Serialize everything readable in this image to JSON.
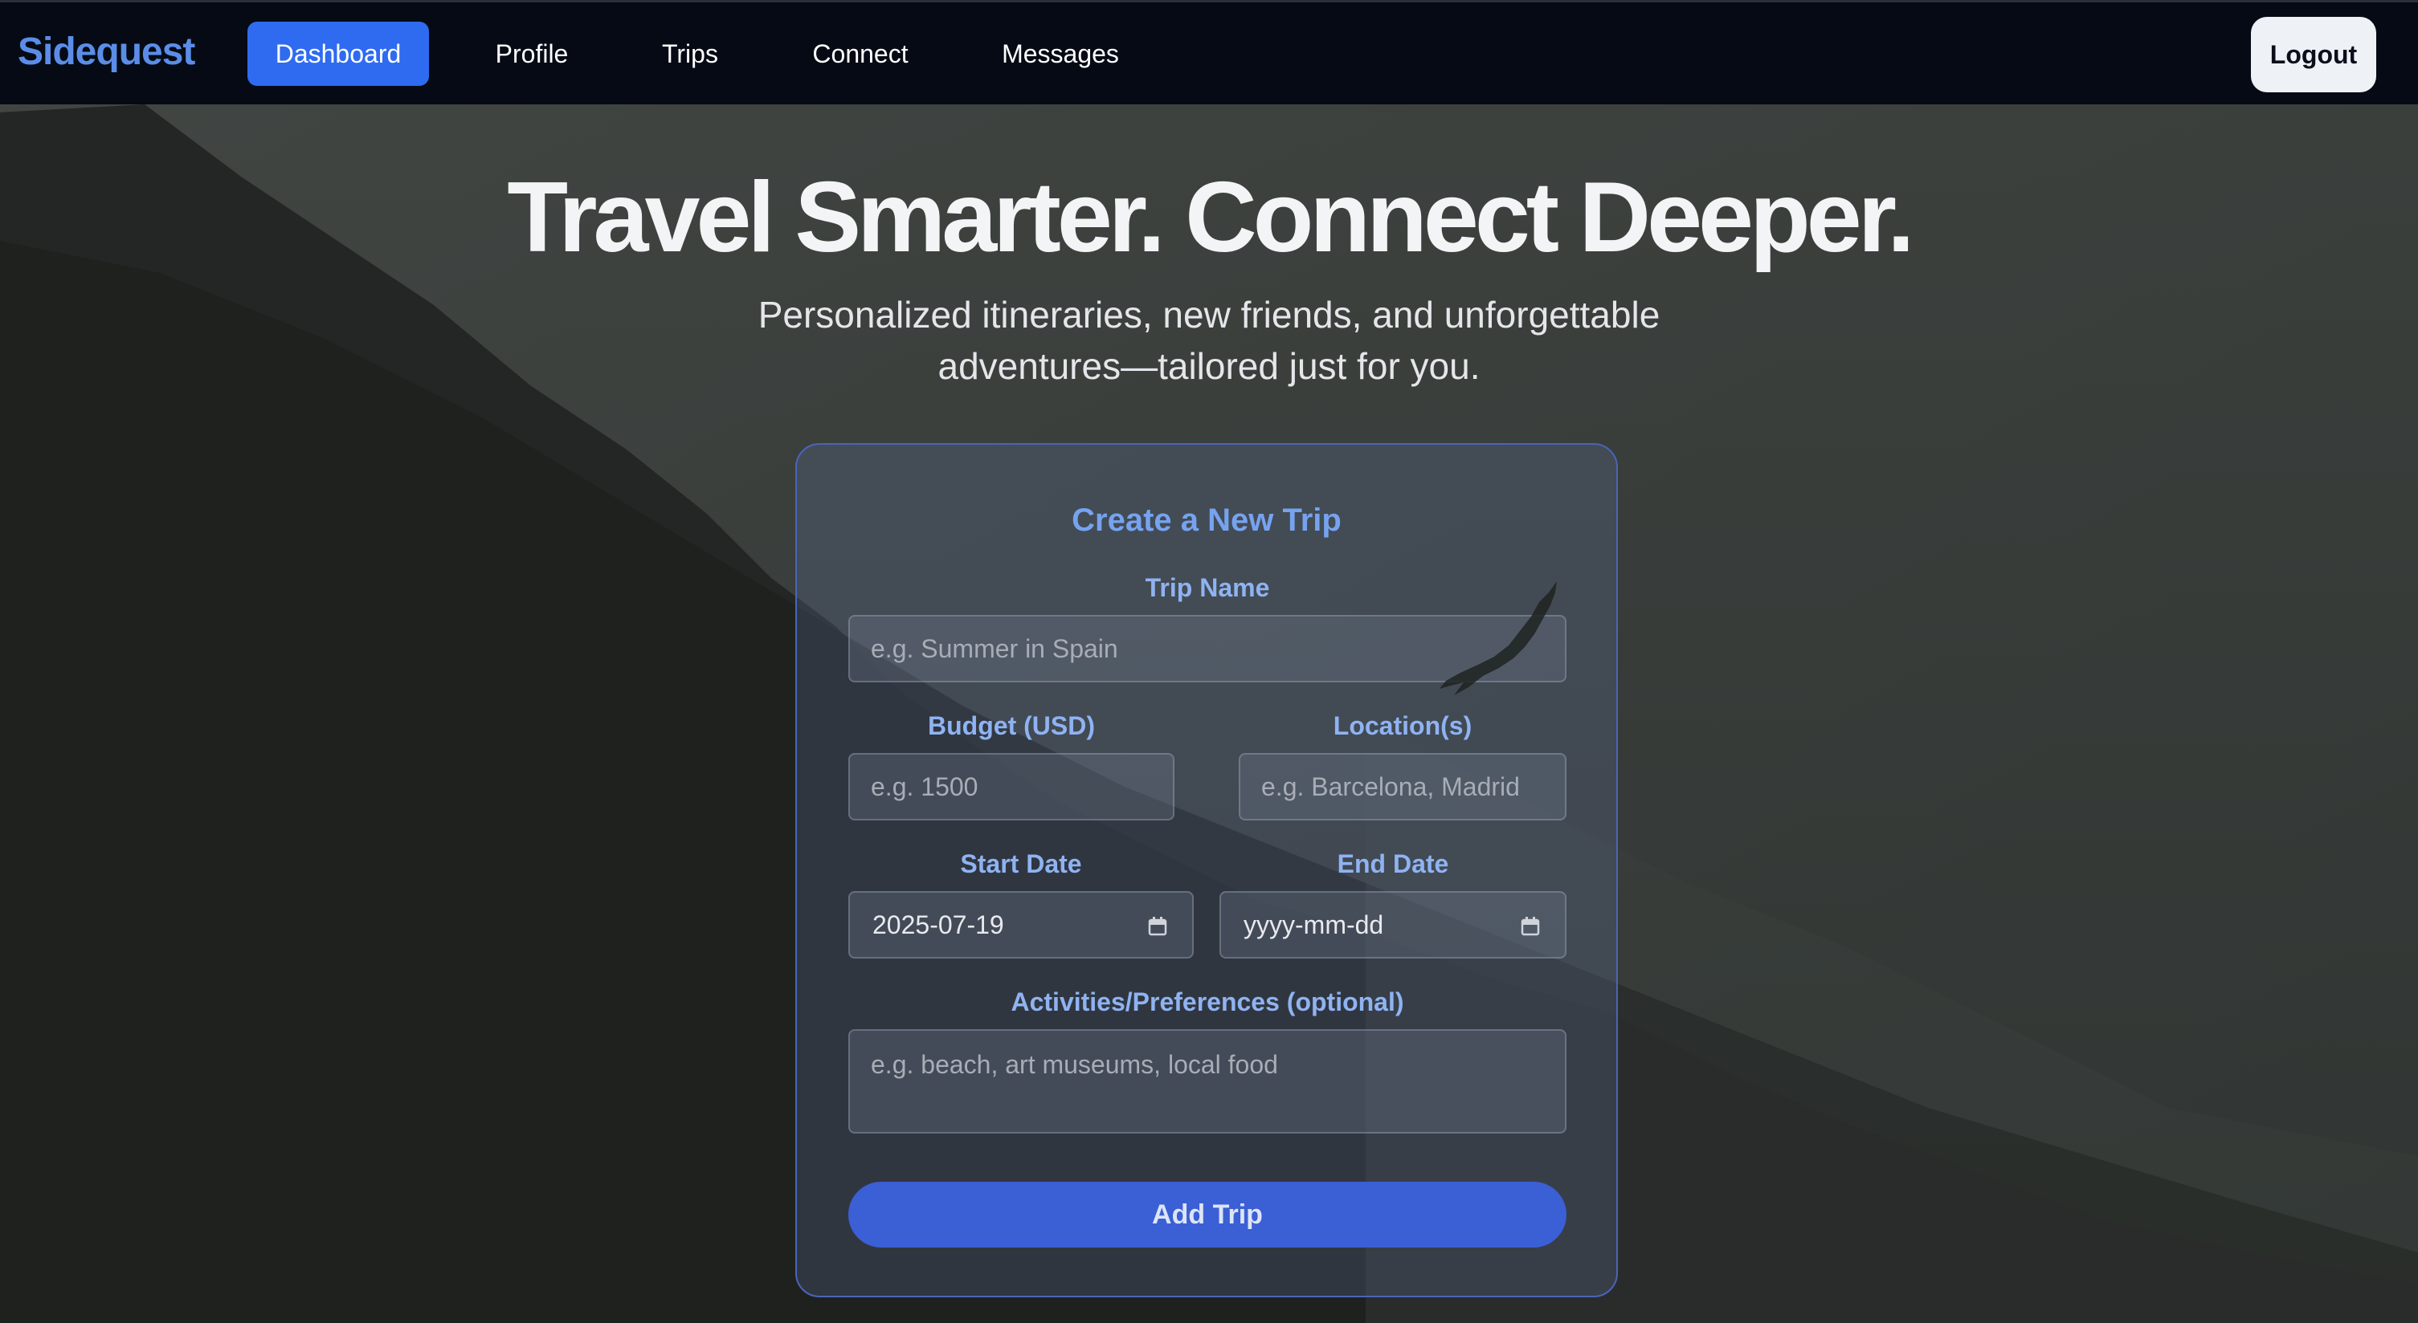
{
  "nav": {
    "brand": "Sidequest",
    "links": [
      {
        "label": "Dashboard",
        "active": true
      },
      {
        "label": "Profile",
        "active": false
      },
      {
        "label": "Trips",
        "active": false
      },
      {
        "label": "Connect",
        "active": false
      },
      {
        "label": "Messages",
        "active": false
      }
    ],
    "logout": "Logout"
  },
  "hero": {
    "title": "Travel Smarter. Connect Deeper.",
    "subtitle_line1": "Personalized itineraries, new friends, and unforgettable",
    "subtitle_line2": "adventures—tailored just for you."
  },
  "form": {
    "title": "Create a New Trip",
    "trip_name": {
      "label": "Trip Name",
      "placeholder": "e.g. Summer in Spain",
      "value": ""
    },
    "budget": {
      "label": "Budget (USD)",
      "placeholder": "e.g. 1500",
      "value": ""
    },
    "locations": {
      "label": "Location(s)",
      "placeholder": "e.g. Barcelona, Madrid",
      "value": ""
    },
    "start_date": {
      "label": "Start Date",
      "value": "2025-07-19"
    },
    "end_date": {
      "label": "End Date",
      "value": "yyyy-mm-dd"
    },
    "activities": {
      "label": "Activities/Preferences (optional)",
      "placeholder": "e.g. beach, art museums, local food",
      "value": ""
    },
    "submit": "Add Trip"
  },
  "colors": {
    "brand": "#5b8de8",
    "active_nav": "#2f6bf0",
    "accent_label": "#8fb3f2",
    "button": "#3b5fd4",
    "navbar_bg": "#050a14"
  },
  "icons": {
    "calendar": "calendar-icon",
    "background_bird": "eagle-silhouette"
  }
}
